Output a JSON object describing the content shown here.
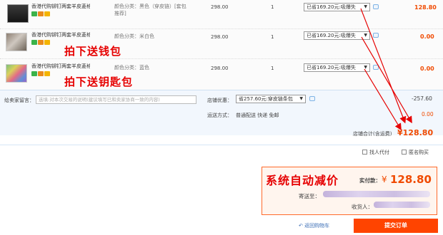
{
  "items": [
    {
      "title": "香港代购铆钉两套羊皮菱格链条...",
      "attr_line1": "颜色分类：黑色（穿皮链）[套包",
      "attr_line2": "推荐]",
      "price": "298.00",
      "qty": "1",
      "discount": "已省169.20元:吸爆失",
      "subtotal": "128.80",
      "annotation": ""
    },
    {
      "title": "香港代购铆钉两套羊皮菱格链条...",
      "attr_line1": "颜色分类：米白色",
      "attr_line2": "",
      "price": "298.00",
      "qty": "1",
      "discount": "已省169.20元:吸爆失",
      "subtotal": "0.00",
      "annotation": "拍下送钱包"
    },
    {
      "title": "香港代购铆钉两套羊皮菱格链条...",
      "attr_line1": "颜色分类：蓝色",
      "attr_line2": "",
      "price": "298.00",
      "qty": "1",
      "discount": "已省169.20元:吸爆失",
      "subtotal": "0.00",
      "annotation": "拍下送钥匙包"
    }
  ],
  "message": {
    "label": "给卖家留言：",
    "placeholder": "选填:对本次交易的说明(建议填写已和卖家协商一致的内容)"
  },
  "shop_promo": {
    "label": "店铺优惠：",
    "selected": "省257.60元:穿皮链条包",
    "amount": "-257.60"
  },
  "shipping": {
    "label": "运送方式：",
    "method": "普通配送 快递 免邮",
    "amount": "0.00"
  },
  "store_total": {
    "label": "店铺合计(含运费)",
    "value": "¥128.80"
  },
  "options": {
    "proxy_pay": "找人代付",
    "anonymous": "匿名购买"
  },
  "pay": {
    "annotation": "系统自动减价",
    "label": "实付款：",
    "currency": "¥",
    "amount": "128.80",
    "address_label": "寄送至：",
    "recipient_label": "收货人："
  },
  "actions": {
    "back": "返回购物车",
    "submit": "提交订单"
  },
  "colors": {
    "accent": "#ff4400",
    "annotation": "#e60000",
    "price": "#f04a00"
  }
}
